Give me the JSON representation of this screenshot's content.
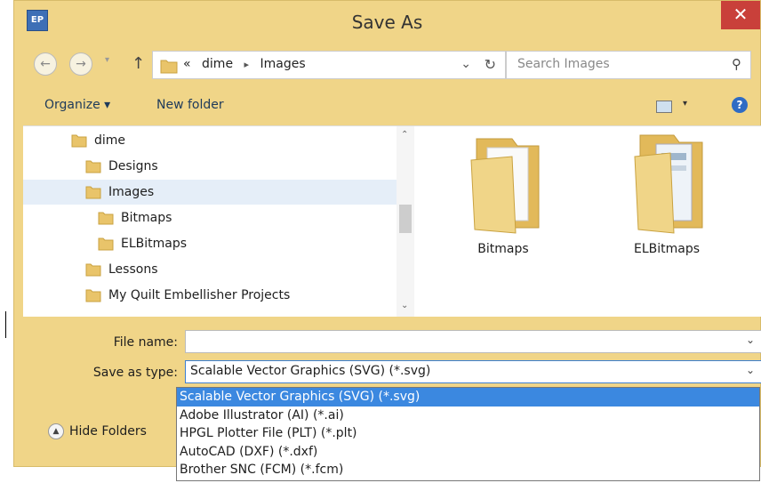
{
  "window": {
    "title": "Save As",
    "app_icon_text": "EP",
    "close_glyph": "✕"
  },
  "nav": {
    "back_glyph": "←",
    "forward_glyph": "→",
    "recent_glyph": "▾",
    "up_glyph": "↑",
    "breadcrumb_prefix": "«",
    "breadcrumb": [
      "dime",
      "Images"
    ],
    "separator_glyph": "▸",
    "dropdown_glyph": "⌄",
    "refresh_glyph": "↻",
    "search_placeholder": "Search Images",
    "search_glyph": "⚲"
  },
  "toolbar": {
    "organize_label": "Organize ▾",
    "new_folder_label": "New folder",
    "view_dropdown_glyph": "▾",
    "help_glyph": "?"
  },
  "tree": {
    "items": [
      {
        "label": "dime",
        "level": 1,
        "selected": false
      },
      {
        "label": "Designs",
        "level": 2,
        "selected": false
      },
      {
        "label": "Images",
        "level": 2,
        "selected": true
      },
      {
        "label": "Bitmaps",
        "level": 3,
        "selected": false
      },
      {
        "label": "ELBitmaps",
        "level": 3,
        "selected": false
      },
      {
        "label": "Lessons",
        "level": 2,
        "selected": false
      },
      {
        "label": "My Quilt Embellisher Projects",
        "level": 2,
        "selected": false
      }
    ],
    "scroll_up_glyph": "⌃",
    "scroll_down_glyph": "⌄"
  },
  "files": [
    {
      "name": "Bitmaps"
    },
    {
      "name": "ELBitmaps"
    }
  ],
  "form": {
    "file_name_label": "File name:",
    "file_name_value": "",
    "save_type_label": "Save as type:",
    "save_type_value": "Scalable Vector Graphics (SVG) (*.svg)",
    "dropdown_glyph": "⌄",
    "type_options": [
      "Scalable Vector Graphics (SVG) (*.svg)",
      "Adobe Illustrator (AI) (*.ai)",
      "HPGL Plotter File (PLT) (*.plt)",
      "AutoCAD (DXF) (*.dxf)",
      "Brother SNC (FCM) (*.fcm)"
    ],
    "hide_folders_label": "Hide Folders",
    "hide_folders_glyph": "▲"
  },
  "colors": {
    "frame": "#f0d588",
    "selection": "#3b88e0",
    "close": "#c9403a",
    "folder": "#e9c46a"
  }
}
